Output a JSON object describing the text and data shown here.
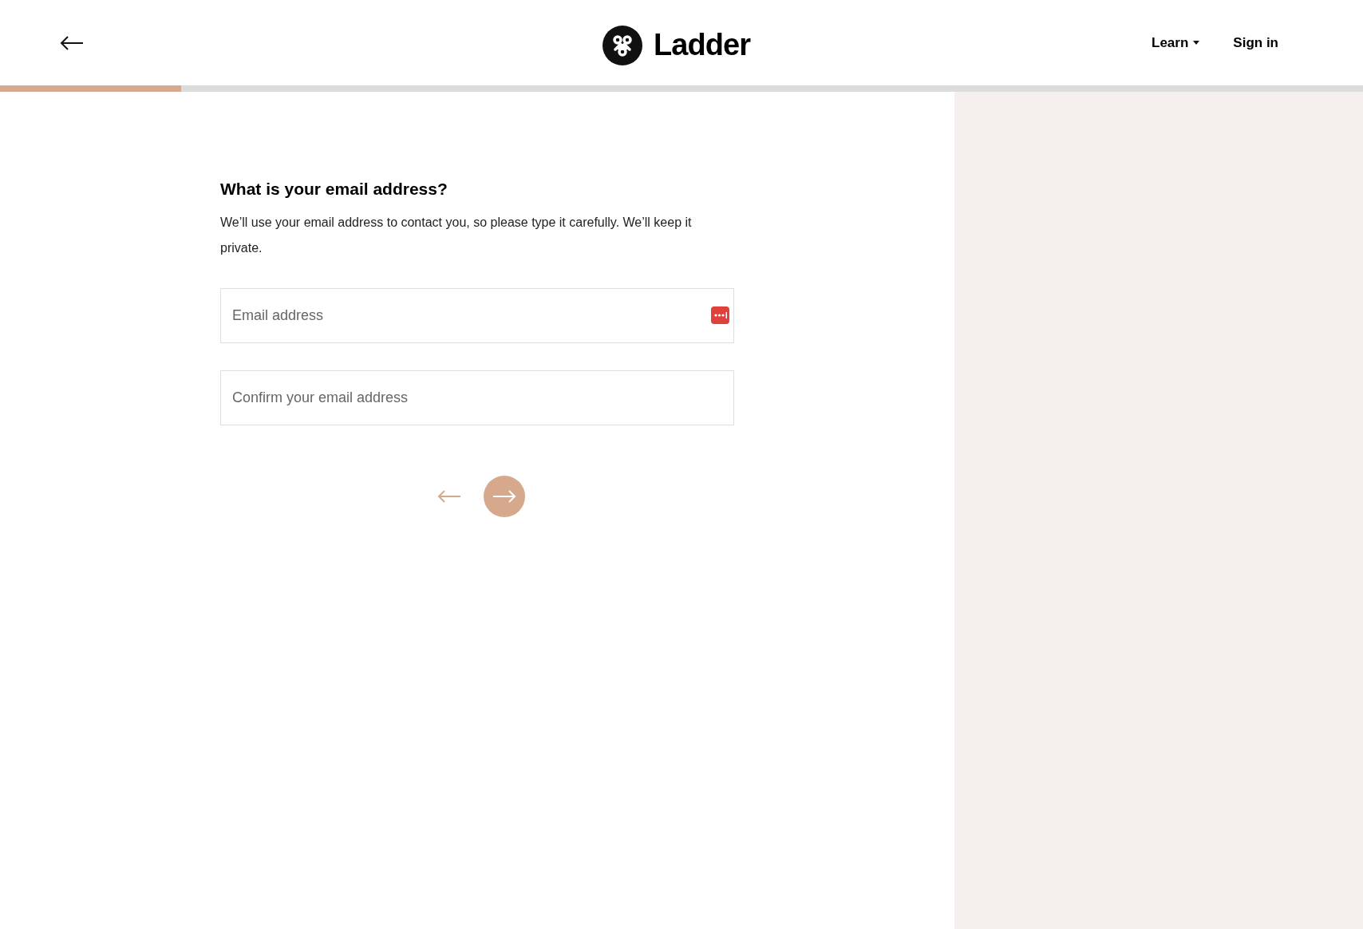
{
  "header": {
    "brand": "Ladder",
    "nav": [
      {
        "label": "Learn",
        "kind": "dropdown"
      },
      {
        "label": "Sign in",
        "kind": "link"
      }
    ]
  },
  "progress": {
    "level": 0.133
  },
  "form": {
    "title": "What is your email address?",
    "description": "We’ll use your email address to contact you, so please type it carefully. We’ll keep it private.",
    "fields": [
      {
        "placeholder": "Email address",
        "autofill": true
      },
      {
        "placeholder": "Confirm your email address",
        "autofill": false
      }
    ]
  }
}
